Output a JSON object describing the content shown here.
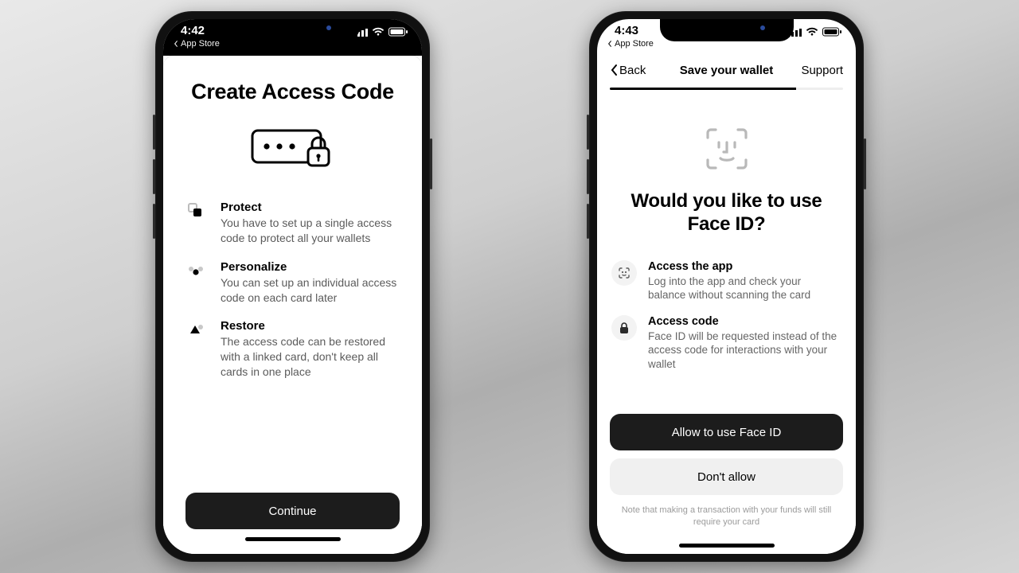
{
  "phones": {
    "left": {
      "status": {
        "time": "4:42",
        "back_label": "App Store"
      },
      "title": "Create Access Code",
      "features": [
        {
          "title": "Protect",
          "body": "You have to set up a single access code to protect all your wallets"
        },
        {
          "title": "Personalize",
          "body": "You can set up an individual access code on each card later"
        },
        {
          "title": "Restore",
          "body": "The access code can be restored with a linked card, don't keep all cards in one place"
        }
      ],
      "cta": "Continue"
    },
    "right": {
      "status": {
        "time": "4:43",
        "back_label": "App Store"
      },
      "nav": {
        "back": "Back",
        "title": "Save your wallet",
        "support": "Support"
      },
      "title": "Would you like to use Face ID?",
      "features": [
        {
          "title": "Access the app",
          "body": "Log into the app and check your balance without scanning the card"
        },
        {
          "title": "Access code",
          "body": "Face ID will be requested instead of the access code for interactions with your wallet"
        }
      ],
      "primary": "Allow to use Face ID",
      "secondary": "Don't allow",
      "footnote": "Note that making a transaction with your funds will still require your card"
    }
  }
}
